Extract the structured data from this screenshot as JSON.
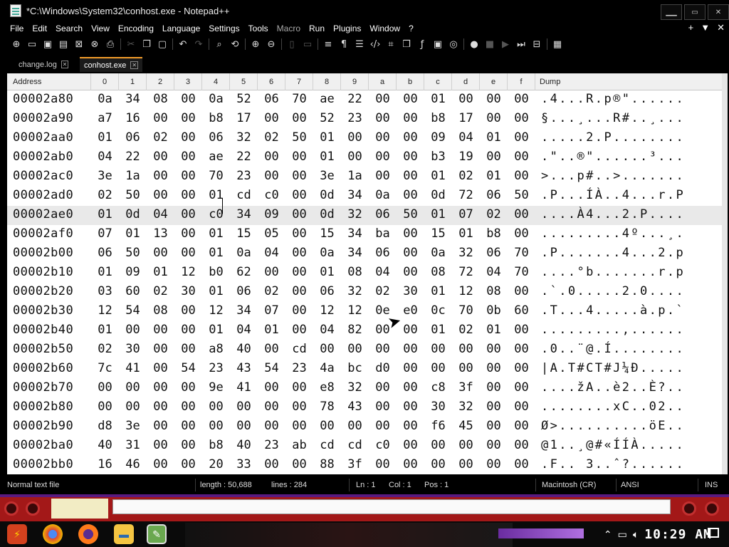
{
  "window": {
    "title": "*C:\\Windows\\System32\\conhost.exe - Notepad++",
    "buttons": [
      "▁▁",
      "▭",
      "✕"
    ]
  },
  "menu": [
    "File",
    "Edit",
    "Search",
    "View",
    "Encoding",
    "Language",
    "Settings",
    "Tools",
    "Macro",
    "Run",
    "Plugins",
    "Window",
    "?"
  ],
  "menu_right": [
    "+",
    "▼",
    "✕"
  ],
  "tabs": [
    {
      "label": "change.log",
      "close": "✕"
    },
    {
      "label": "conhost.exe",
      "close": "✕"
    }
  ],
  "hex_header": {
    "address": "Address",
    "columns": [
      "0",
      "1",
      "2",
      "3",
      "4",
      "5",
      "6",
      "7",
      "8",
      "9",
      "a",
      "b",
      "c",
      "d",
      "e",
      "f"
    ],
    "dump": "Dump"
  },
  "rows": [
    {
      "addr": "00002a80",
      "bytes": [
        "0a",
        "34",
        "08",
        "00",
        "0a",
        "52",
        "06",
        "70",
        "ae",
        "22",
        "00",
        "00",
        "01",
        "00",
        "00",
        "00"
      ],
      "dump": ".4...R.p®\"......"
    },
    {
      "addr": "00002a90",
      "bytes": [
        "a7",
        "16",
        "00",
        "00",
        "b8",
        "17",
        "00",
        "00",
        "52",
        "23",
        "00",
        "00",
        "b8",
        "17",
        "00",
        "00"
      ],
      "dump": "§...¸...R#..¸..."
    },
    {
      "addr": "00002aa0",
      "bytes": [
        "01",
        "06",
        "02",
        "00",
        "06",
        "32",
        "02",
        "50",
        "01",
        "00",
        "00",
        "00",
        "09",
        "04",
        "01",
        "00"
      ],
      "dump": ".....2.P........"
    },
    {
      "addr": "00002ab0",
      "bytes": [
        "04",
        "22",
        "00",
        "00",
        "ae",
        "22",
        "00",
        "00",
        "01",
        "00",
        "00",
        "00",
        "b3",
        "19",
        "00",
        "00"
      ],
      "dump": ".\"..®\"......³..."
    },
    {
      "addr": "00002ac0",
      "bytes": [
        "3e",
        "1a",
        "00",
        "00",
        "70",
        "23",
        "00",
        "00",
        "3e",
        "1a",
        "00",
        "00",
        "01",
        "02",
        "01",
        "00"
      ],
      "dump": ">...p#..>......."
    },
    {
      "addr": "00002ad0",
      "bytes": [
        "02",
        "50",
        "00",
        "00",
        "01",
        "cd",
        "c0",
        "00",
        "0d",
        "34",
        "0a",
        "00",
        "0d",
        "72",
        "06",
        "50"
      ],
      "dump": ".P...ÍÀ..4...r.P"
    },
    {
      "addr": "00002ae0",
      "bytes": [
        "01",
        "0d",
        "04",
        "00",
        "c0",
        "34",
        "09",
        "00",
        "0d",
        "32",
        "06",
        "50",
        "01",
        "07",
        "02",
        "00"
      ],
      "dump": "....À4...2.P...."
    },
    {
      "addr": "00002af0",
      "bytes": [
        "07",
        "01",
        "13",
        "00",
        "01",
        "15",
        "05",
        "00",
        "15",
        "34",
        "ba",
        "00",
        "15",
        "01",
        "b8",
        "00"
      ],
      "dump": ".........4º...¸."
    },
    {
      "addr": "00002b00",
      "bytes": [
        "06",
        "50",
        "00",
        "00",
        "01",
        "0a",
        "04",
        "00",
        "0a",
        "34",
        "06",
        "00",
        "0a",
        "32",
        "06",
        "70"
      ],
      "dump": ".P.......4...2.p"
    },
    {
      "addr": "00002b10",
      "bytes": [
        "01",
        "09",
        "01",
        "12",
        "b0",
        "62",
        "00",
        "00",
        "01",
        "08",
        "04",
        "00",
        "08",
        "72",
        "04",
        "70"
      ],
      "dump": "....°b.......r.p"
    },
    {
      "addr": "00002b20",
      "bytes": [
        "03",
        "60",
        "02",
        "30",
        "01",
        "06",
        "02",
        "00",
        "06",
        "32",
        "02",
        "30",
        "01",
        "12",
        "08",
        "00"
      ],
      "dump": ".`.0.....2.0...."
    },
    {
      "addr": "00002b30",
      "bytes": [
        "12",
        "54",
        "08",
        "00",
        "12",
        "34",
        "07",
        "00",
        "12",
        "12",
        "0e",
        "e0",
        "0c",
        "70",
        "0b",
        "60"
      ],
      "dump": ".T...4.....à.p.`"
    },
    {
      "addr": "00002b40",
      "bytes": [
        "01",
        "00",
        "00",
        "00",
        "01",
        "04",
        "01",
        "00",
        "04",
        "82",
        "00",
        "00",
        "01",
        "02",
        "01",
        "00"
      ],
      "dump": ".........‚......"
    },
    {
      "addr": "00002b50",
      "bytes": [
        "02",
        "30",
        "00",
        "00",
        "a8",
        "40",
        "00",
        "cd",
        "00",
        "00",
        "00",
        "00",
        "00",
        "00",
        "00",
        "00"
      ],
      "dump": ".0..¨@.Í........"
    },
    {
      "addr": "00002b60",
      "bytes": [
        "7c",
        "41",
        "00",
        "54",
        "23",
        "43",
        "54",
        "23",
        "4a",
        "bc",
        "d0",
        "00",
        "00",
        "00",
        "00",
        "00"
      ],
      "dump": "|A.T#CT#J¼Ð....."
    },
    {
      "addr": "00002b70",
      "bytes": [
        "00",
        "00",
        "00",
        "00",
        "9e",
        "41",
        "00",
        "00",
        "e8",
        "32",
        "00",
        "00",
        "c8",
        "3f",
        "00",
        "00"
      ],
      "dump": "....žA..è2..È?.."
    },
    {
      "addr": "00002b80",
      "bytes": [
        "00",
        "00",
        "00",
        "00",
        "00",
        "00",
        "00",
        "00",
        "78",
        "43",
        "00",
        "00",
        "30",
        "32",
        "00",
        "00"
      ],
      "dump": "........xC..02.."
    },
    {
      "addr": "00002b90",
      "bytes": [
        "d8",
        "3e",
        "00",
        "00",
        "00",
        "00",
        "00",
        "00",
        "00",
        "00",
        "00",
        "00",
        "f6",
        "45",
        "00",
        "00"
      ],
      "dump": "Ø>..........öE.."
    },
    {
      "addr": "00002ba0",
      "bytes": [
        "40",
        "31",
        "00",
        "00",
        "b8",
        "40",
        "23",
        "ab",
        "cd",
        "cd",
        "c0",
        "00",
        "00",
        "00",
        "00",
        "00"
      ],
      "dump": "@1..¸@#«ÍÍÀ....."
    },
    {
      "addr": "00002bb0",
      "bytes": [
        "16",
        "46",
        "00",
        "00",
        "20",
        "33",
        "00",
        "00",
        "88",
        "3f",
        "00",
        "00",
        "00",
        "00",
        "00",
        "00"
      ],
      "dump": ".F.. 3..ˆ?......"
    }
  ],
  "status": {
    "file_type": "Normal text file",
    "length": "length : 50,688",
    "lines": "lines : 284",
    "ln": "Ln : 1",
    "col": "Col : 1",
    "pos": "Pos : 1",
    "eol": "Macintosh (CR)",
    "encoding": "ANSI",
    "mode": "INS"
  },
  "taskbar": {
    "clock": "10:29 AM"
  }
}
